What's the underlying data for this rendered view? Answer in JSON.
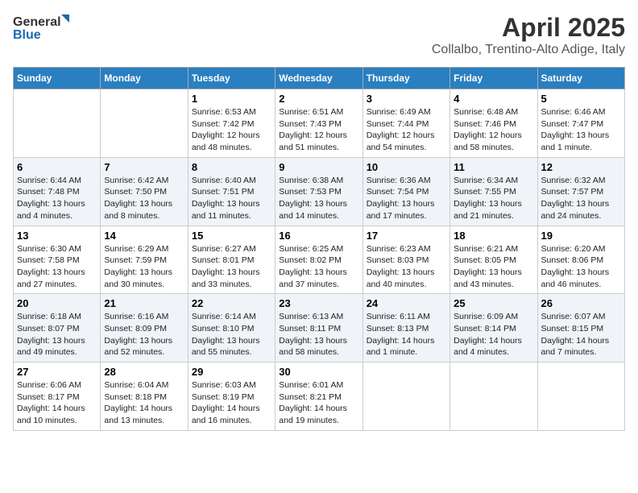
{
  "header": {
    "logo_general": "General",
    "logo_blue": "Blue",
    "title": "April 2025",
    "subtitle": "Collalbo, Trentino-Alto Adige, Italy"
  },
  "columns": [
    "Sunday",
    "Monday",
    "Tuesday",
    "Wednesday",
    "Thursday",
    "Friday",
    "Saturday"
  ],
  "weeks": [
    [
      {
        "day": "",
        "info": ""
      },
      {
        "day": "",
        "info": ""
      },
      {
        "day": "1",
        "info": "Sunrise: 6:53 AM\nSunset: 7:42 PM\nDaylight: 12 hours\nand 48 minutes."
      },
      {
        "day": "2",
        "info": "Sunrise: 6:51 AM\nSunset: 7:43 PM\nDaylight: 12 hours\nand 51 minutes."
      },
      {
        "day": "3",
        "info": "Sunrise: 6:49 AM\nSunset: 7:44 PM\nDaylight: 12 hours\nand 54 minutes."
      },
      {
        "day": "4",
        "info": "Sunrise: 6:48 AM\nSunset: 7:46 PM\nDaylight: 12 hours\nand 58 minutes."
      },
      {
        "day": "5",
        "info": "Sunrise: 6:46 AM\nSunset: 7:47 PM\nDaylight: 13 hours\nand 1 minute."
      }
    ],
    [
      {
        "day": "6",
        "info": "Sunrise: 6:44 AM\nSunset: 7:48 PM\nDaylight: 13 hours\nand 4 minutes."
      },
      {
        "day": "7",
        "info": "Sunrise: 6:42 AM\nSunset: 7:50 PM\nDaylight: 13 hours\nand 8 minutes."
      },
      {
        "day": "8",
        "info": "Sunrise: 6:40 AM\nSunset: 7:51 PM\nDaylight: 13 hours\nand 11 minutes."
      },
      {
        "day": "9",
        "info": "Sunrise: 6:38 AM\nSunset: 7:53 PM\nDaylight: 13 hours\nand 14 minutes."
      },
      {
        "day": "10",
        "info": "Sunrise: 6:36 AM\nSunset: 7:54 PM\nDaylight: 13 hours\nand 17 minutes."
      },
      {
        "day": "11",
        "info": "Sunrise: 6:34 AM\nSunset: 7:55 PM\nDaylight: 13 hours\nand 21 minutes."
      },
      {
        "day": "12",
        "info": "Sunrise: 6:32 AM\nSunset: 7:57 PM\nDaylight: 13 hours\nand 24 minutes."
      }
    ],
    [
      {
        "day": "13",
        "info": "Sunrise: 6:30 AM\nSunset: 7:58 PM\nDaylight: 13 hours\nand 27 minutes."
      },
      {
        "day": "14",
        "info": "Sunrise: 6:29 AM\nSunset: 7:59 PM\nDaylight: 13 hours\nand 30 minutes."
      },
      {
        "day": "15",
        "info": "Sunrise: 6:27 AM\nSunset: 8:01 PM\nDaylight: 13 hours\nand 33 minutes."
      },
      {
        "day": "16",
        "info": "Sunrise: 6:25 AM\nSunset: 8:02 PM\nDaylight: 13 hours\nand 37 minutes."
      },
      {
        "day": "17",
        "info": "Sunrise: 6:23 AM\nSunset: 8:03 PM\nDaylight: 13 hours\nand 40 minutes."
      },
      {
        "day": "18",
        "info": "Sunrise: 6:21 AM\nSunset: 8:05 PM\nDaylight: 13 hours\nand 43 minutes."
      },
      {
        "day": "19",
        "info": "Sunrise: 6:20 AM\nSunset: 8:06 PM\nDaylight: 13 hours\nand 46 minutes."
      }
    ],
    [
      {
        "day": "20",
        "info": "Sunrise: 6:18 AM\nSunset: 8:07 PM\nDaylight: 13 hours\nand 49 minutes."
      },
      {
        "day": "21",
        "info": "Sunrise: 6:16 AM\nSunset: 8:09 PM\nDaylight: 13 hours\nand 52 minutes."
      },
      {
        "day": "22",
        "info": "Sunrise: 6:14 AM\nSunset: 8:10 PM\nDaylight: 13 hours\nand 55 minutes."
      },
      {
        "day": "23",
        "info": "Sunrise: 6:13 AM\nSunset: 8:11 PM\nDaylight: 13 hours\nand 58 minutes."
      },
      {
        "day": "24",
        "info": "Sunrise: 6:11 AM\nSunset: 8:13 PM\nDaylight: 14 hours\nand 1 minute."
      },
      {
        "day": "25",
        "info": "Sunrise: 6:09 AM\nSunset: 8:14 PM\nDaylight: 14 hours\nand 4 minutes."
      },
      {
        "day": "26",
        "info": "Sunrise: 6:07 AM\nSunset: 8:15 PM\nDaylight: 14 hours\nand 7 minutes."
      }
    ],
    [
      {
        "day": "27",
        "info": "Sunrise: 6:06 AM\nSunset: 8:17 PM\nDaylight: 14 hours\nand 10 minutes."
      },
      {
        "day": "28",
        "info": "Sunrise: 6:04 AM\nSunset: 8:18 PM\nDaylight: 14 hours\nand 13 minutes."
      },
      {
        "day": "29",
        "info": "Sunrise: 6:03 AM\nSunset: 8:19 PM\nDaylight: 14 hours\nand 16 minutes."
      },
      {
        "day": "30",
        "info": "Sunrise: 6:01 AM\nSunset: 8:21 PM\nDaylight: 14 hours\nand 19 minutes."
      },
      {
        "day": "",
        "info": ""
      },
      {
        "day": "",
        "info": ""
      },
      {
        "day": "",
        "info": ""
      }
    ]
  ]
}
